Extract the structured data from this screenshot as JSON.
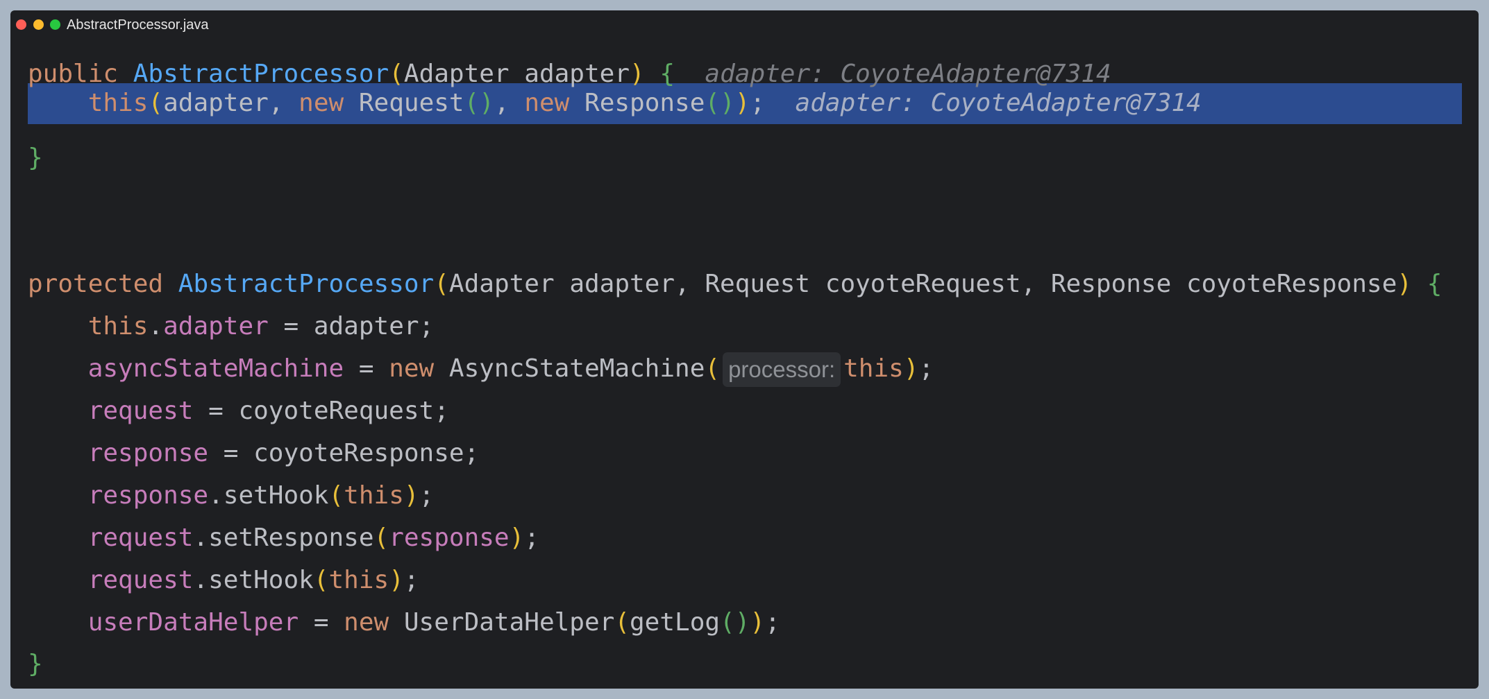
{
  "window": {
    "title": "AbstractProcessor.java"
  },
  "colors": {
    "keyword": "#cf8e6d",
    "method_declaration": "#56a8f5",
    "field": "#c77dbb",
    "plain": "#bcbec4",
    "bracket_outer": "#e8bf3a",
    "bracket_inner": "#5fad65",
    "debug_hint": "#7d7f85",
    "selection": "#2c4c90",
    "editor_background": "#1e1f22"
  },
  "code": {
    "l1": {
      "kw_public": "public",
      "method": "AbstractProcessor",
      "paren_open": "(",
      "params": "Adapter adapter",
      "paren_close": ")",
      "brace": "{",
      "debug_hint": "adapter: CoyoteAdapter@7314"
    },
    "l2": {
      "kw_this": "this",
      "paren_open": "(",
      "arg1": "adapter, ",
      "kw_new1": "new",
      "type1": " Request",
      "call1": "()",
      "sep": ", ",
      "kw_new2": "new",
      "type2": " Response",
      "call2": "()",
      "paren_close": ")",
      "semi": ";",
      "debug_hint": "adapter: CoyoteAdapter@7314"
    },
    "l3": {
      "brace": "}"
    },
    "l4": {
      "kw_protected": "protected",
      "method": "AbstractProcessor",
      "paren_open": "(",
      "params": "Adapter adapter, Request coyoteRequest, Response coyoteResponse",
      "paren_close": ")",
      "brace": "{"
    },
    "l5": {
      "kw_this": "this",
      "dot": ".",
      "field": "adapter",
      "rest": " = adapter;"
    },
    "l6": {
      "field": "asyncStateMachine",
      "assign": " = ",
      "kw_new": "new",
      "type": " AsyncStateMachine",
      "paren_open": "(",
      "inlay_hint": "processor:",
      "kw_this": "this",
      "paren_close": ")",
      "semi": ";"
    },
    "l7": {
      "field": "request",
      "rest": " = coyoteRequest;"
    },
    "l8": {
      "field": "response",
      "rest": " = coyoteResponse;"
    },
    "l9": {
      "field": "response",
      "call": ".setHook",
      "paren_open": "(",
      "kw_this": "this",
      "paren_close": ")",
      "semi": ";"
    },
    "l10": {
      "field": "request",
      "call": ".setResponse",
      "paren_open": "(",
      "arg_field": "response",
      "paren_close": ")",
      "semi": ";"
    },
    "l11": {
      "field": "request",
      "call": ".setHook",
      "paren_open": "(",
      "kw_this": "this",
      "paren_close": ")",
      "semi": ";"
    },
    "l12": {
      "field": "userDataHelper",
      "assign": " = ",
      "kw_new": "new",
      "type": " UserDataHelper",
      "paren_open": "(",
      "inner_call": "getLog",
      "inner_parens": "()",
      "paren_close": ")",
      "semi": ";"
    },
    "l13": {
      "brace": "}"
    }
  }
}
